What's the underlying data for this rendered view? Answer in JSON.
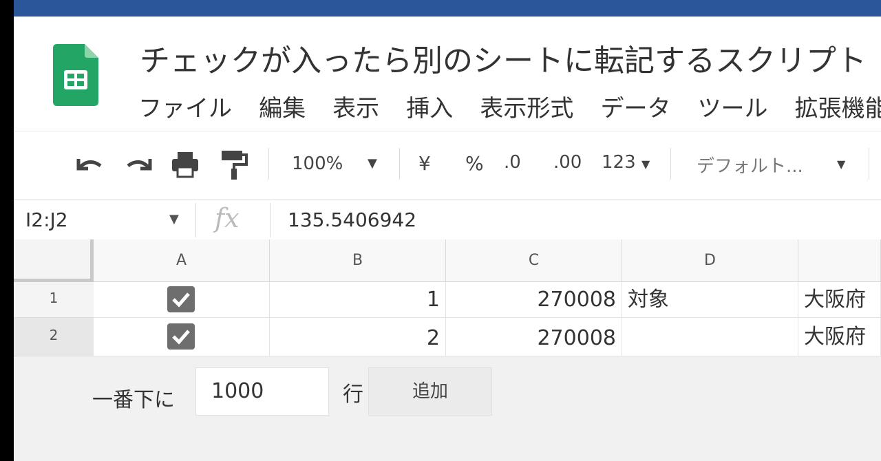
{
  "document": {
    "title": "チェックが入ったら別のシートに転記するスクリプト"
  },
  "menu": {
    "items": [
      "ファイル",
      "編集",
      "表示",
      "挿入",
      "表示形式",
      "データ",
      "ツール",
      "拡張機能"
    ]
  },
  "toolbar": {
    "undo_icon": "undo-icon",
    "redo_icon": "redo-icon",
    "print_icon": "print-icon",
    "paint_format_icon": "paint-format-icon",
    "zoom": "100%",
    "currency": "¥",
    "percent": "%",
    "decrease_decimal": ".0",
    "increase_decimal": ".00",
    "number_format": "123",
    "font_name": "デフォルト..."
  },
  "formula_bar": {
    "name_box": "I2:J2",
    "fx": "fx",
    "value": "135.5406942"
  },
  "sheet": {
    "columns": [
      "A",
      "B",
      "C",
      "D"
    ],
    "rows": [
      {
        "row": "1",
        "checked": true,
        "b": "1",
        "c": "270008",
        "d": "対象",
        "e": "大阪府"
      },
      {
        "row": "2",
        "checked": true,
        "b": "2",
        "c": "270008",
        "d": "",
        "e": "大阪府"
      }
    ]
  },
  "add_rows": {
    "prefix": "一番下に",
    "count": "1000",
    "suffix": "行",
    "button": "追加"
  },
  "colors": {
    "top_bar": "#2b579a",
    "sheets_green": "#23a566",
    "checkbox": "#6e6e6e"
  }
}
